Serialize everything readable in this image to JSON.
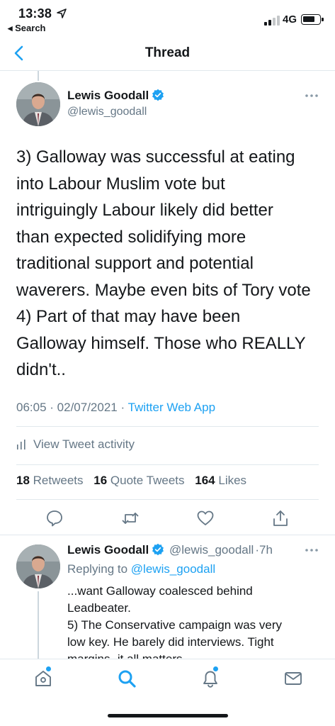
{
  "status_bar": {
    "time": "13:38",
    "back_app": "◂ Search",
    "network": "4G",
    "battery_level": 0.75
  },
  "header": {
    "title": "Thread"
  },
  "main_tweet": {
    "author_name": "Lewis Goodall",
    "author_handle": "@lewis_goodall",
    "text": "3) Galloway was successful at eating\ninto Labour Muslim vote but\nintriguingly Labour likely did better\nthan expected solidifying more\ntraditional support and potential\nwaverers. Maybe even bits of Tory vote\n4) Part of that may have been\nGalloway himself. Those who REALLY\ndidn't..",
    "time": "06:05",
    "date": "02/07/2021",
    "source": "Twitter Web App",
    "view_activity_label": "View Tweet activity",
    "retweets_count": "18",
    "retweets_label": "Retweets",
    "quote_count": "16",
    "quote_label": "Quote Tweets",
    "likes_count": "164",
    "likes_label": "Likes"
  },
  "reply_tweet": {
    "author_name": "Lewis Goodall",
    "author_handle": "@lewis_goodall",
    "age": "7h",
    "replying_prefix": "Replying to",
    "replying_to": "@lewis_goodall",
    "text": "...want Galloway coalesced behind\nLeadbeater.\n5) The Conservative campaign was very\nlow key. He barely did interviews. Tight\nmargins- it all matters"
  },
  "colors": {
    "accent": "#1da1f2",
    "text_primary": "#14171a",
    "text_secondary": "#657786",
    "divider": "#e1e8ed"
  },
  "icons": {
    "verified": "verified-badge-icon",
    "more": "more-horizontal-icon",
    "reply": "reply-icon",
    "retweet": "retweet-icon",
    "like": "heart-icon",
    "share": "share-icon",
    "home_tab": "home-icon",
    "search_tab": "search-icon",
    "notifications_tab": "bell-icon",
    "messages_tab": "mail-icon"
  }
}
